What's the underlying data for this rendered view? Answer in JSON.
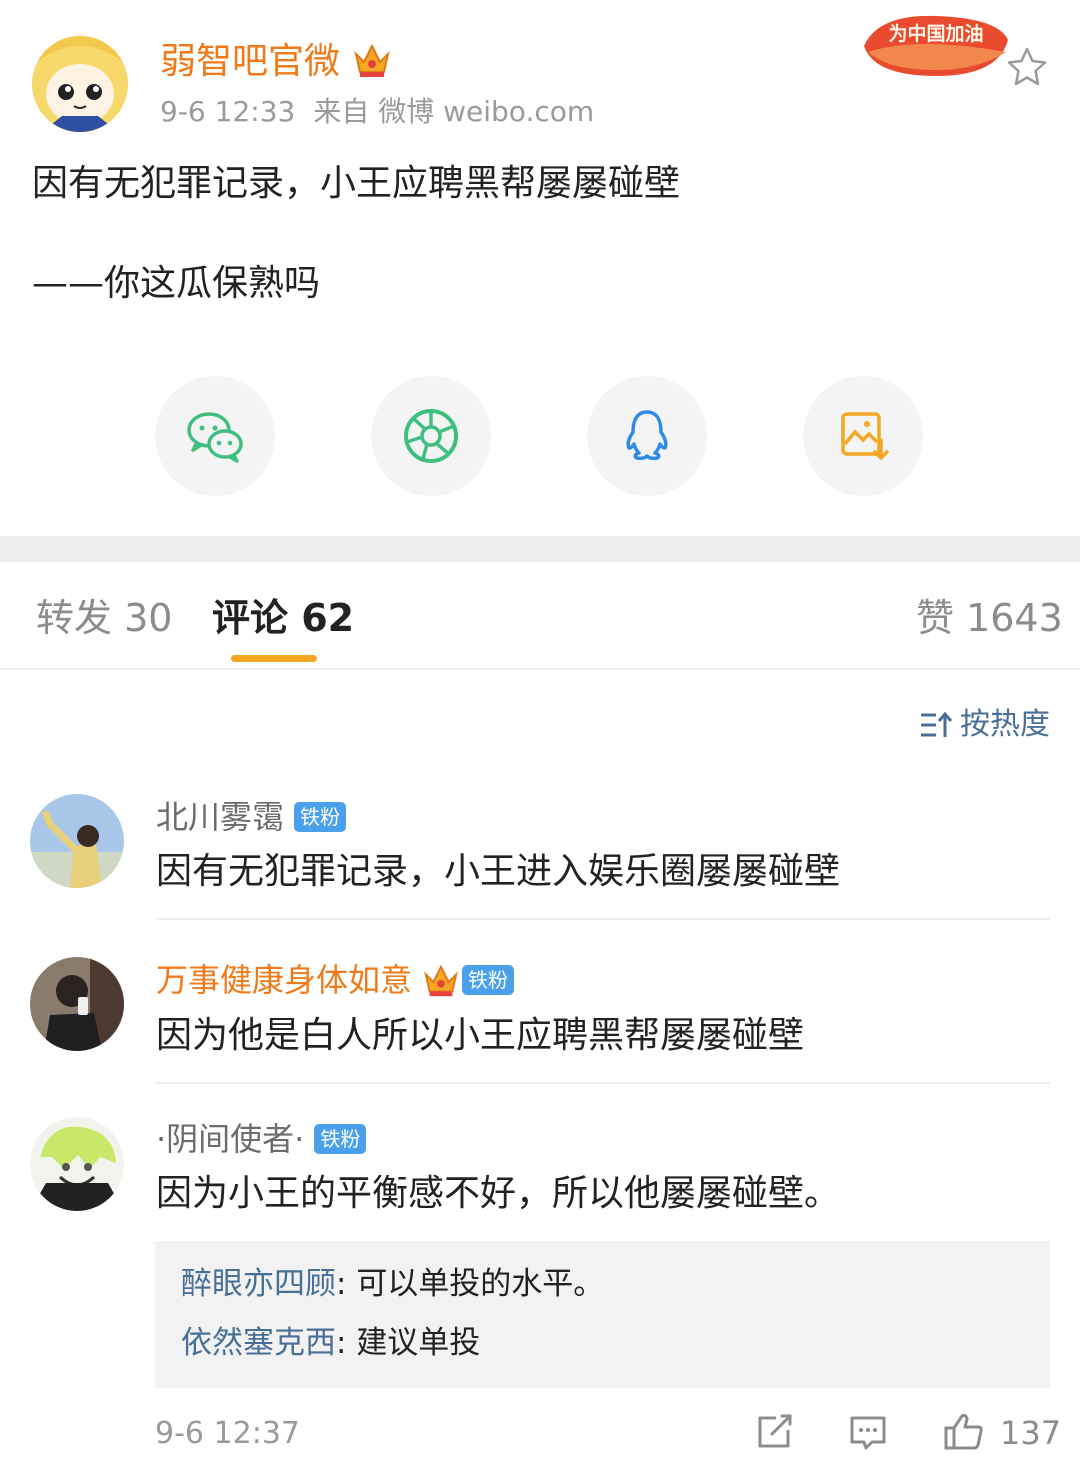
{
  "post": {
    "author": "弱智吧官微",
    "time": "9-6 12:33",
    "source": "来自 微博 weibo.com",
    "badge_text": "为中国加油",
    "lines": [
      "因有无犯罪记录，小王应聘黑帮屡屡碰壁",
      "——你这瓜保熟吗"
    ]
  },
  "share": [
    {
      "icon": "wechat-icon",
      "color": "#3fbf7f"
    },
    {
      "icon": "moments-icon",
      "color": "#3fbf7f"
    },
    {
      "icon": "qq-icon",
      "color": "#2f8be8"
    },
    {
      "icon": "save-image-icon",
      "color": "#f5a623"
    }
  ],
  "tabs": {
    "repost": "转发 30",
    "comments": "评论 62",
    "likes": "赞 1643"
  },
  "sort_label": "按热度",
  "fan_badge": "铁粉",
  "comments": [
    {
      "name": "北川雾霭",
      "text": "因有无犯罪记录，小王进入娱乐圈屡屡碰壁"
    },
    {
      "name": "万事健康身体如意",
      "text": "因为他是白人所以小王应聘黑帮屡屡碰壁"
    },
    {
      "name": "·阴间使者·",
      "text": "因为小王的平衡感不好，所以他屡屡碰壁。"
    }
  ],
  "replies": [
    {
      "name": "醉眼亦四顾",
      "sep": ": ",
      "text": "可以单投的水平。"
    },
    {
      "name": "依然塞克西",
      "sep": ": ",
      "text": "建议单投"
    }
  ],
  "footer": {
    "time": "9-6 12:37",
    "like_count": "137"
  },
  "colors": {
    "accent": "#f5a623",
    "author": "#f07a1a",
    "link": "#4a6f97",
    "fan_badge": "#4aa0ea"
  }
}
